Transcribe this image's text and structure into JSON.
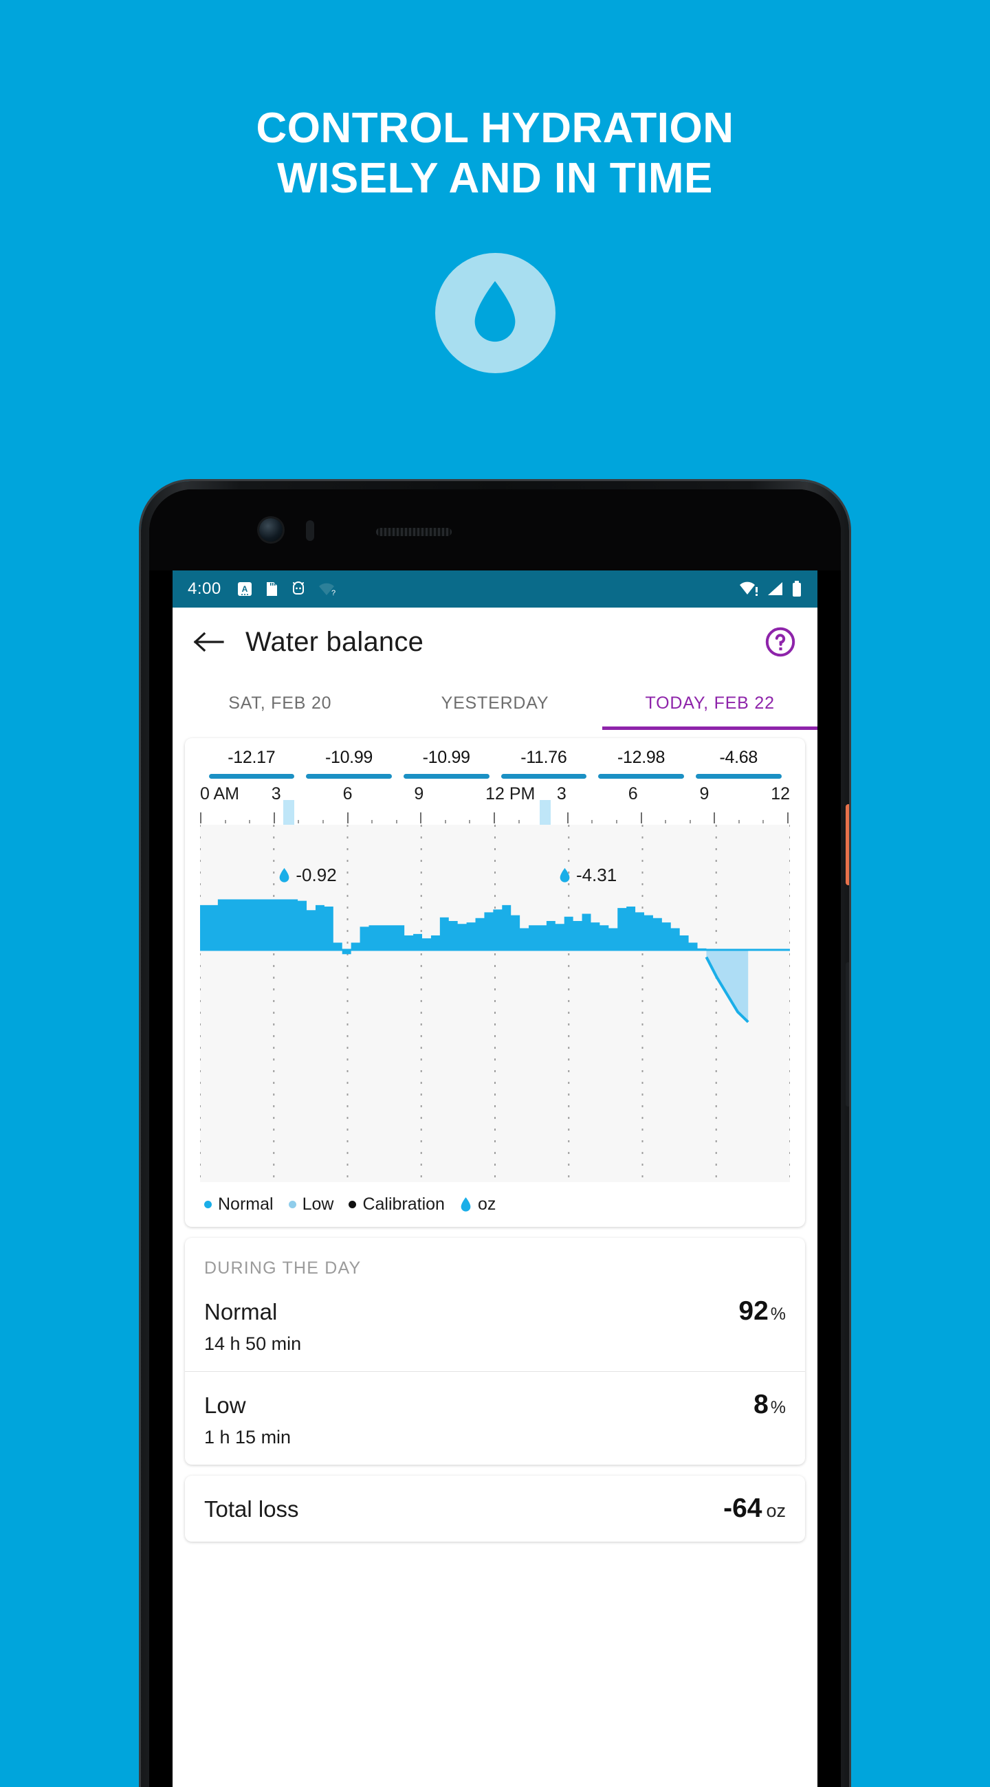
{
  "promo": {
    "headline_line1": "CONTROL HYDRATION",
    "headline_line2": "WISELY AND IN TIME",
    "logo_icon": "water-drop-icon",
    "background_color": "#00A5DC",
    "logo_circle_color": "#A8DEF0"
  },
  "status_bar": {
    "time": "4:00",
    "left_icons": [
      "letter-a-badge-icon",
      "sd-card-icon",
      "android-debug-icon",
      "wifi-unknown-icon"
    ],
    "right_icons": [
      "wifi-alert-icon",
      "cell-signal-icon",
      "battery-full-icon"
    ],
    "background_color": "#0a6b8a"
  },
  "app_bar": {
    "back_icon": "arrow-back-icon",
    "title": "Water balance",
    "help_icon": "help-circle-icon",
    "accent_color": "#8E24AA"
  },
  "tabs": [
    {
      "label": "SAT, FEB 20",
      "active": false
    },
    {
      "label": "YESTERDAY",
      "active": false
    },
    {
      "label": "TODAY, FEB 22",
      "active": true
    }
  ],
  "chart_data": {
    "type": "area",
    "title": "Water balance",
    "unit": "oz",
    "summary_values": [
      "-12.17",
      "-10.99",
      "-10.99",
      "-11.76",
      "-12.98",
      "-4.68"
    ],
    "xlabel": "",
    "ylabel": "oz",
    "tick_labels": [
      "0 AM",
      "3",
      "6",
      "9",
      "12 PM",
      "3",
      "6",
      "9",
      "12"
    ],
    "x": [
      0,
      3,
      6,
      9,
      12,
      15,
      18,
      21,
      24
    ],
    "xlim": [
      0,
      24
    ],
    "ylim": [
      -5,
      1
    ],
    "grid": true,
    "legend_position": "bottom",
    "legend": [
      {
        "label": "Normal",
        "color": "#1AAEE8",
        "marker": "dot"
      },
      {
        "label": "Low",
        "color": "#8FCDEB",
        "marker": "dot"
      },
      {
        "label": "Calibration",
        "color": "#111111",
        "marker": "dot"
      },
      {
        "label": "oz",
        "color": "#1AAEE8",
        "marker": "drop"
      }
    ],
    "annotations": [
      {
        "label": "-0.92",
        "value": -0.92,
        "x_hour": 3.2,
        "marker": "water-drop-icon"
      },
      {
        "label": "-4.31",
        "value": -4.31,
        "x_hour": 14.6,
        "marker": "water-drop-icon"
      }
    ],
    "series": [
      {
        "name": "Normal",
        "color": "#1AAEE8",
        "values": [
          0.62,
          0.62,
          0.7,
          0.7,
          0.7,
          0.7,
          0.7,
          0.7,
          0.7,
          0.7,
          0.7,
          0.68,
          0.55,
          0.62,
          0.6,
          0.1,
          -0.06,
          0.1,
          0.32,
          0.34,
          0.34,
          0.34,
          0.34,
          0.2,
          0.22,
          0.16,
          0.2,
          0.45,
          0.4,
          0.36,
          0.38,
          0.44,
          0.52,
          0.56,
          0.62,
          0.48,
          0.3,
          0.34,
          0.34,
          0.4,
          0.36,
          0.46,
          0.4,
          0.5,
          0.38,
          0.34,
          0.3,
          0.58,
          0.6,
          0.52,
          0.48,
          0.44,
          0.38,
          0.3,
          0.2,
          0.1,
          0.02,
          -0.1
        ]
      },
      {
        "name": "Low",
        "color": "#AEDDF5",
        "values": [
          -0.1,
          -0.38,
          -0.62,
          -0.86,
          -1.0
        ]
      }
    ],
    "highlight_bands": [
      {
        "x_hour": 3.5,
        "color": "#BFE6F8"
      },
      {
        "x_hour": 14.0,
        "color": "#BFE6F8"
      }
    ]
  },
  "stats": {
    "section_title": "DURING THE DAY",
    "rows": [
      {
        "name": "Normal",
        "value": "92",
        "unit": "%",
        "sub": "14 h 50 min"
      },
      {
        "name": "Low",
        "value": "8",
        "unit": "%",
        "sub": "1 h 15 min"
      }
    ]
  },
  "total": {
    "label": "Total loss",
    "value": "-64",
    "unit": "oz"
  }
}
